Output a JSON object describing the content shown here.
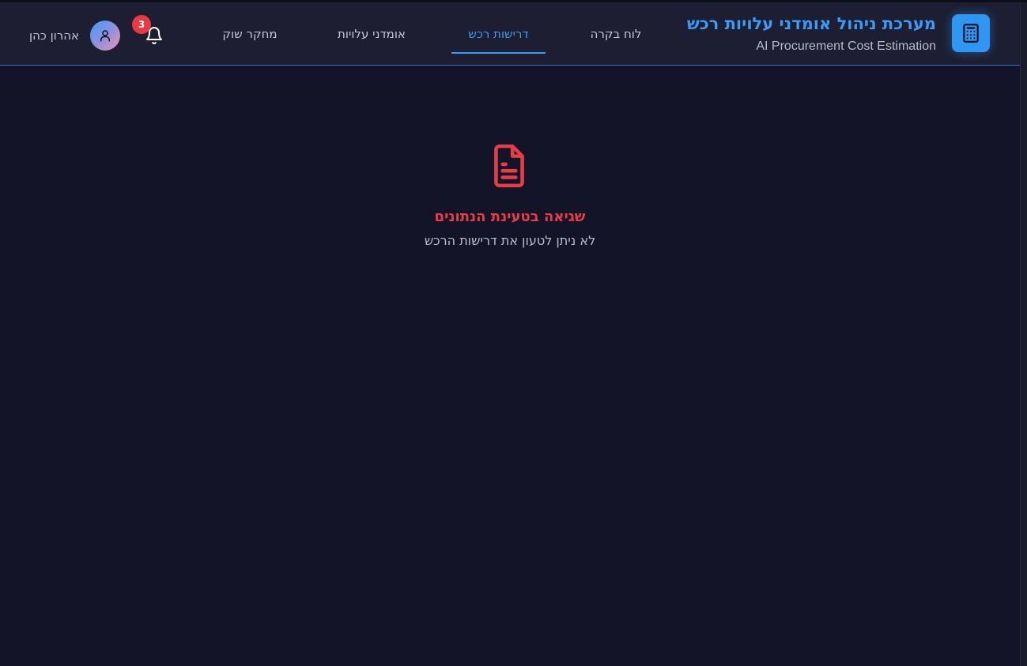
{
  "header": {
    "title": "מערכת ניהול אומדני עלויות רכש",
    "subtitle": "AI Procurement Cost Estimation",
    "brand_icon": "calculator-icon"
  },
  "nav": {
    "tabs": [
      {
        "label": "לוח בקרה",
        "active": false
      },
      {
        "label": "דרישות רכש",
        "active": true
      },
      {
        "label": "אומדני עלויות",
        "active": false
      },
      {
        "label": "מחקר שוק",
        "active": false
      }
    ]
  },
  "notifications": {
    "icon": "bell-icon",
    "count": "3"
  },
  "user": {
    "name": "אהרון כהן",
    "avatar_icon": "user-icon"
  },
  "error": {
    "icon": "file-text-icon",
    "title": "שגיאה בטעינת הנתונים",
    "message": "לא ניתן לטעון את דרישות הרכש"
  },
  "colors": {
    "background": "#131427",
    "header": "#1d1e31",
    "accent": "#3b9bf5",
    "error": "#e63d47"
  }
}
